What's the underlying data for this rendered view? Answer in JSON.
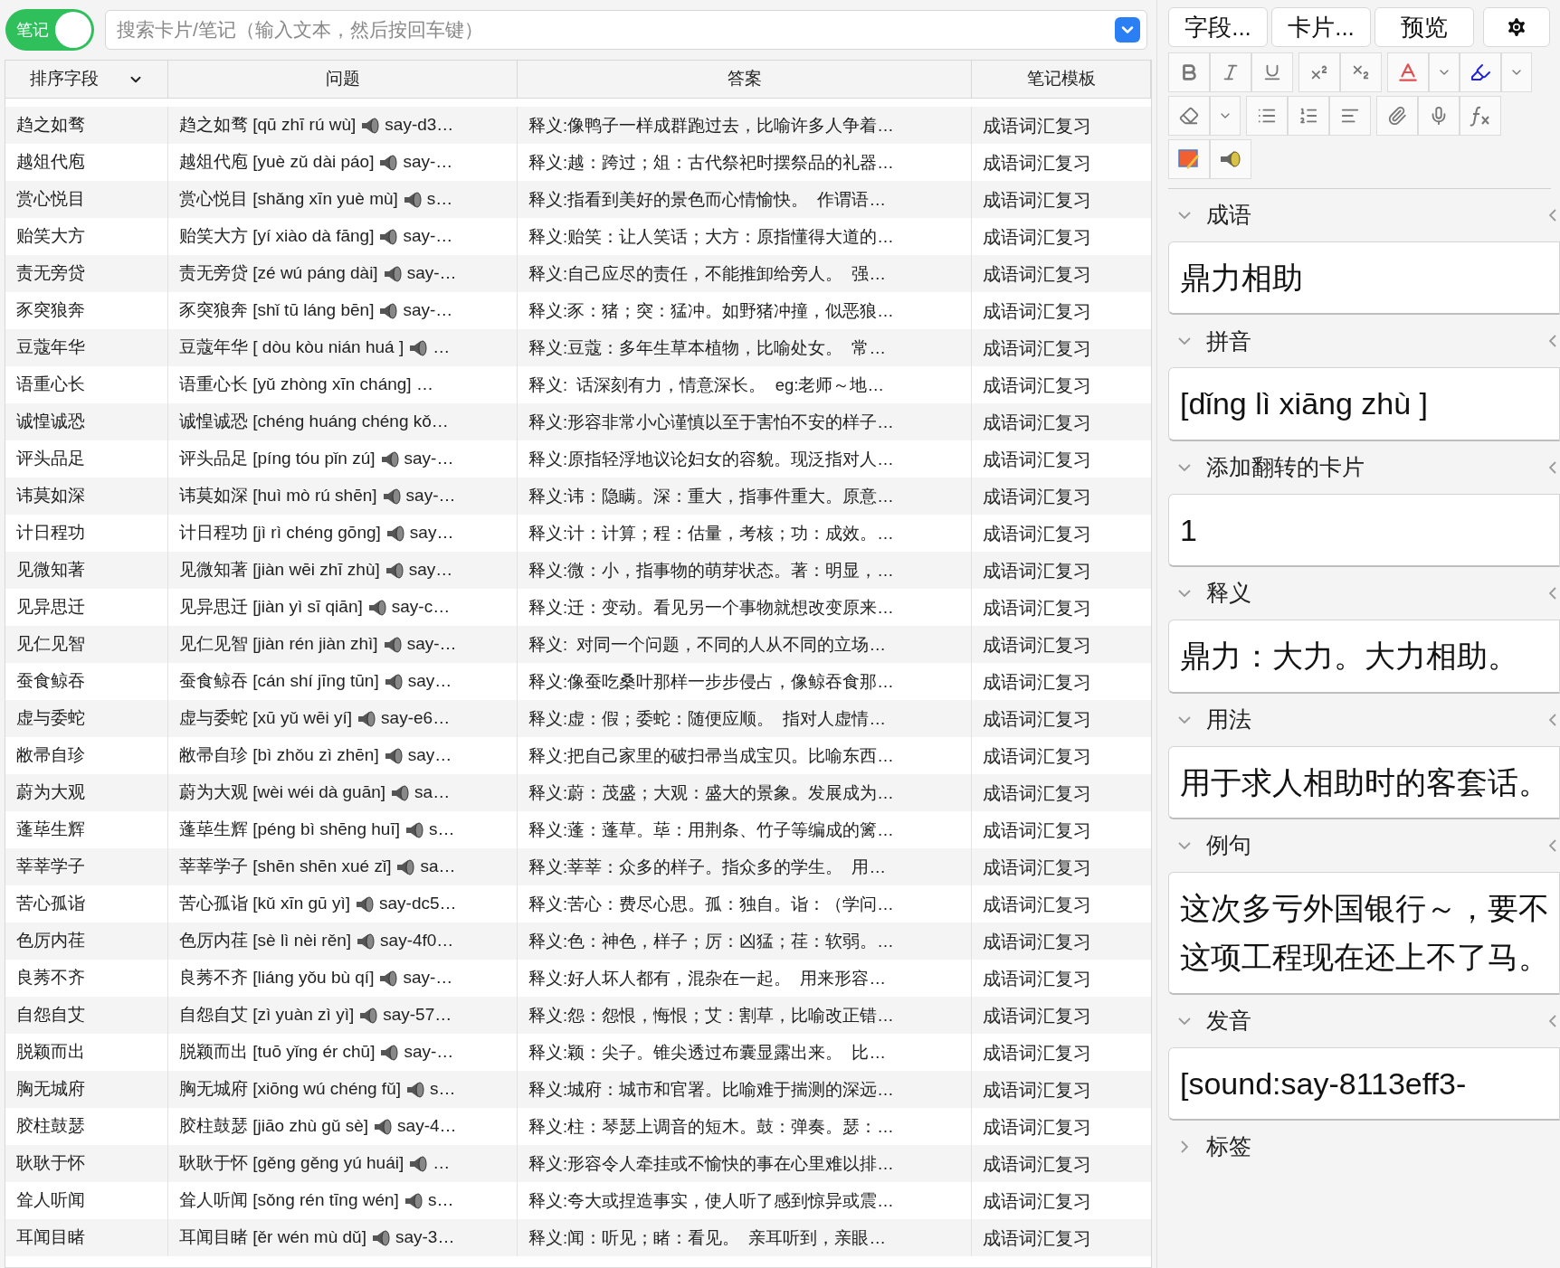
{
  "toggle": {
    "label": "笔记",
    "on": true
  },
  "search": {
    "placeholder": "搜索卡片/笔记（输入文本，然后按回车键）"
  },
  "table": {
    "columns": [
      {
        "label": "排序字段",
        "kind": "dropdown"
      },
      {
        "label": "问题",
        "kind": "plain"
      },
      {
        "label": "答案",
        "kind": "plain"
      },
      {
        "label": "笔记模板",
        "kind": "plain"
      }
    ],
    "rows": [
      {
        "sort": "趋之如骛",
        "question": "趋之如骛 [qū zhī rú wù]",
        "audio_icon": true,
        "question_tail": "say-d3…",
        "answer": "释义:像鸭子一样成群跑过去，比喻许多人争着…",
        "template": "成语词汇复习"
      },
      {
        "sort": "越俎代庖",
        "question": "越俎代庖 [yuè zǔ dài páo]",
        "audio_icon": true,
        "question_tail": "say-…",
        "answer": "释义:越：跨过；俎：古代祭祀时摆祭品的礼器…",
        "template": "成语词汇复习"
      },
      {
        "sort": "赏心悦目",
        "question": "赏心悦目 [shǎng xīn yuè mù]",
        "audio_icon": true,
        "question_tail": "s…",
        "answer": "释义:指看到美好的景色而心情愉快。  作谓语…",
        "template": "成语词汇复习"
      },
      {
        "sort": "贻笑大方",
        "question": "贻笑大方 [yí xiào dà fāng]",
        "audio_icon": true,
        "question_tail": "say-…",
        "answer": "释义:贻笑：让人笑话；大方：原指懂得大道的…",
        "template": "成语词汇复习"
      },
      {
        "sort": "责无旁贷",
        "question": "责无旁贷 [zé wú páng dài]",
        "audio_icon": true,
        "question_tail": "say-…",
        "answer": "释义:自己应尽的责任，不能推卸给旁人。  强…",
        "template": "成语词汇复习"
      },
      {
        "sort": "豕突狼奔",
        "question": "豕突狼奔 [shǐ tū láng bēn]",
        "audio_icon": true,
        "question_tail": "say-…",
        "answer": "释义:豕：猪；突：猛冲。如野猪冲撞，似恶狼…",
        "template": "成语词汇复习"
      },
      {
        "sort": "豆蔻年华",
        "question": "豆蔻年华 [ dòu kòu nián huá ]",
        "audio_icon": true,
        "question_tail": "…",
        "answer": "释义:豆蔻：多年生草本植物，比喻处女。  常…",
        "template": "成语词汇复习"
      },
      {
        "sort": "语重心长",
        "question": "语重心长 [yǔ zhòng xīn cháng] …",
        "audio_icon": false,
        "answer": "释义:  话深刻有力，情意深长。  eg:老师～地…",
        "template": "成语词汇复习"
      },
      {
        "sort": "诚惶诚恐",
        "question": "诚惶诚恐 [chéng huáng chéng kǒ…",
        "audio_icon": false,
        "answer": "释义:形容非常小心谨慎以至于害怕不安的样子…",
        "template": "成语词汇复习"
      },
      {
        "sort": "评头品足",
        "question": "评头品足 [píng tóu pǐn zú]",
        "audio_icon": true,
        "question_tail": "say-…",
        "answer": "释义:原指轻浮地议论妇女的容貌。现泛指对人…",
        "template": "成语词汇复习"
      },
      {
        "sort": "讳莫如深",
        "question": "讳莫如深 [huì mò rú shēn]",
        "audio_icon": true,
        "question_tail": "say-…",
        "answer": "释义:讳：隐瞒。深：重大，指事件重大。原意…",
        "template": "成语词汇复习"
      },
      {
        "sort": "计日程功",
        "question": "计日程功 [jì rì chéng gōng]",
        "audio_icon": true,
        "question_tail": "say…",
        "answer": "释义:计：计算；程：估量，考核；功：成效。…",
        "template": "成语词汇复习"
      },
      {
        "sort": "见微知著",
        "question": "见微知著 [jiàn wēi zhī zhù]",
        "audio_icon": true,
        "question_tail": "say…",
        "answer": "释义:微：小，指事物的萌芽状态。著：明显，…",
        "template": "成语词汇复习"
      },
      {
        "sort": "见异思迁",
        "question": "见异思迁 [jiàn yì sī qiān]",
        "audio_icon": true,
        "question_tail": "say-c…",
        "answer": "释义:迁：变动。看见另一个事物就想改变原来…",
        "template": "成语词汇复习"
      },
      {
        "sort": "见仁见智",
        "question": "见仁见智 [jiàn rén jiàn zhì]",
        "audio_icon": true,
        "question_tail": "say-…",
        "answer": "释义:  对同一个问题，不同的人从不同的立场…",
        "template": "成语词汇复习"
      },
      {
        "sort": "蚕食鲸吞",
        "question": "蚕食鲸吞 [cán shí jīng tūn]",
        "audio_icon": true,
        "question_tail": "say…",
        "answer": "释义:像蚕吃桑叶那样一步步侵占，像鲸吞食那…",
        "template": "成语词汇复习"
      },
      {
        "sort": "虚与委蛇",
        "question": "虚与委蛇 [xū yǔ wēi yí]",
        "audio_icon": true,
        "question_tail": "say-e6…",
        "answer": "释义:虚：假；委蛇：随便应顺。  指对人虚情…",
        "template": "成语词汇复习"
      },
      {
        "sort": "敝帚自珍",
        "question": "敝帚自珍 [bì zhǒu zì zhēn]",
        "audio_icon": true,
        "question_tail": "say…",
        "answer": "释义:把自己家里的破扫帚当成宝贝。比喻东西…",
        "template": "成语词汇复习"
      },
      {
        "sort": "蔚为大观",
        "question": "蔚为大观 [wèi wéi dà guān]",
        "audio_icon": true,
        "question_tail": "sa…",
        "answer": "释义:蔚：茂盛；大观：盛大的景象。发展成为…",
        "template": "成语词汇复习"
      },
      {
        "sort": "蓬荜生辉",
        "question": "蓬荜生辉 [péng bì shēng huī]",
        "audio_icon": true,
        "question_tail": "s…",
        "answer": "释义:蓬：蓬草。荜：用荆条、竹子等编成的篱…",
        "template": "成语词汇复习"
      },
      {
        "sort": "莘莘学子",
        "question": "莘莘学子 [shēn shēn xué zǐ]",
        "audio_icon": true,
        "question_tail": "sa…",
        "answer": "释义:莘莘：众多的样子。指众多的学生。  用…",
        "template": "成语词汇复习"
      },
      {
        "sort": "苦心孤诣",
        "question": "苦心孤诣 [kǔ xīn gū yì]",
        "audio_icon": true,
        "question_tail": "say-dc5…",
        "answer": "释义:苦心：费尽心思。孤：独自。诣：（学问…",
        "template": "成语词汇复习"
      },
      {
        "sort": "色厉内荏",
        "question": "色厉内荏 [sè lì nèi rěn]",
        "audio_icon": true,
        "question_tail": "say-4f0…",
        "answer": "释义:色：神色，样子；厉：凶猛；荏：软弱。…",
        "template": "成语词汇复习"
      },
      {
        "sort": "良莠不齐",
        "question": "良莠不齐 [liáng yǒu bù qí]",
        "audio_icon": true,
        "question_tail": "say-…",
        "answer": "释义:好人坏人都有，混杂在一起。  用来形容…",
        "template": "成语词汇复习"
      },
      {
        "sort": "自怨自艾",
        "question": "自怨自艾 [zì yuàn zì yì]",
        "audio_icon": true,
        "question_tail": "say-57…",
        "answer": "释义:怨：怨恨，悔恨；艾：割草，比喻改正错…",
        "template": "成语词汇复习"
      },
      {
        "sort": "脱颖而出",
        "question": "脱颖而出 [tuō yǐng ér chū]",
        "audio_icon": true,
        "question_tail": "say-…",
        "answer": "释义:颖：尖子。锥尖透过布囊显露出来。  比…",
        "template": "成语词汇复习"
      },
      {
        "sort": "胸无城府",
        "question": "胸无城府 [xiōng wú chéng fǔ]",
        "audio_icon": true,
        "question_tail": "s…",
        "answer": "释义:城府：城市和官署。比喻难于揣测的深远…",
        "template": "成语词汇复习"
      },
      {
        "sort": "胶柱鼓瑟",
        "question": "胶柱鼓瑟 [jiāo zhù gǔ sè]",
        "audio_icon": true,
        "question_tail": "say-4…",
        "answer": "释义:柱：琴瑟上调音的短木。鼓：弹奏。瑟：…",
        "template": "成语词汇复习"
      },
      {
        "sort": "耿耿于怀",
        "question": "耿耿于怀 [gěng gěng yú huái]",
        "audio_icon": true,
        "question_tail": "…",
        "answer": "释义:形容令人牵挂或不愉快的事在心里难以排…",
        "template": "成语词汇复习"
      },
      {
        "sort": "耸人听闻",
        "question": "耸人听闻 [sǒng rén tīng wén]",
        "audio_icon": true,
        "question_tail": "s…",
        "answer": "释义:夸大或捏造事实，使人听了感到惊异或震…",
        "template": "成语词汇复习"
      },
      {
        "sort": "耳闻目睹",
        "question": "耳闻目睹 [ěr wén mù dǔ]",
        "audio_icon": true,
        "question_tail": "say-3…",
        "answer": "释义:闻：听见；睹：看见。  亲耳听到，亲眼…",
        "template": "成语词汇复习"
      }
    ]
  },
  "editor": {
    "buttons": [
      "字段...",
      "卡片...",
      "预览"
    ],
    "fields": [
      {
        "label": "成语",
        "expanded": true,
        "value": "鼎力相助"
      },
      {
        "label": "拼音",
        "expanded": true,
        "value": "[dǐng lì xiāng zhù ]"
      },
      {
        "label": "添加翻转的卡片",
        "expanded": true,
        "value": "1"
      },
      {
        "label": "释义",
        "expanded": true,
        "value": "鼎力：大力。大力相助。"
      },
      {
        "label": "用法",
        "expanded": true,
        "value": "用于求人相助时的客套话。"
      },
      {
        "label": "例句",
        "expanded": true,
        "value": "这次多亏外国银行～，要不这项工程现在还上不了马。"
      },
      {
        "label": "发音",
        "expanded": true,
        "value": "[sound:say-8113eff3-"
      },
      {
        "label": "标签",
        "expanded": false
      }
    ]
  }
}
